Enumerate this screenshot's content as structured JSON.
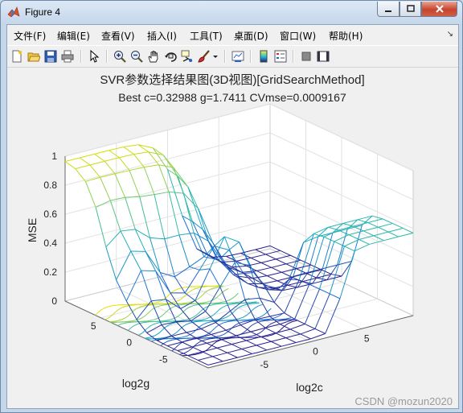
{
  "window": {
    "title": "Figure 4"
  },
  "menu": [
    "文件(F)",
    "编辑(E)",
    "查看(V)",
    "插入(I)",
    "工具(T)",
    "桌面(D)",
    "窗口(W)",
    "帮助(H)"
  ],
  "toolbar_icons": [
    "new-figure-icon",
    "open-file-icon",
    "save-icon",
    "print-icon",
    "pointer-icon",
    "zoom-in-icon",
    "zoom-out-icon",
    "pan-hand-icon",
    "rotate-3d-icon",
    "data-cursor-icon",
    "brush-icon",
    "brush-dropdown-icon",
    "link-plot-icon",
    "colorbar-icon",
    "legend-icon",
    "hide-plot-tools-icon",
    "show-plot-tools-icon"
  ],
  "chart_data": {
    "type": "surface",
    "title": "SVR参数选择结果图(3D视图)[GridSearchMethod]",
    "subtitle": "Best c=0.32988 g=1.7411 CVmse=0.0009167",
    "xlabel": "log2c",
    "ylabel": "log2g",
    "zlabel": "MSE",
    "z_ticks": [
      "0",
      "0.2",
      "0.4",
      "0.6",
      "0.8",
      "1"
    ],
    "g_ticks": [
      "5",
      "0",
      "-5"
    ],
    "c_ticks": [
      "-5",
      "0",
      "5"
    ],
    "zlim": [
      0,
      1
    ],
    "grid": true,
    "colormap": [
      "#2a1b8a",
      "#1f6fd0",
      "#18b0c0",
      "#6fcc70",
      "#e8e000"
    ]
  },
  "watermark": "CSDN @mozun2020"
}
